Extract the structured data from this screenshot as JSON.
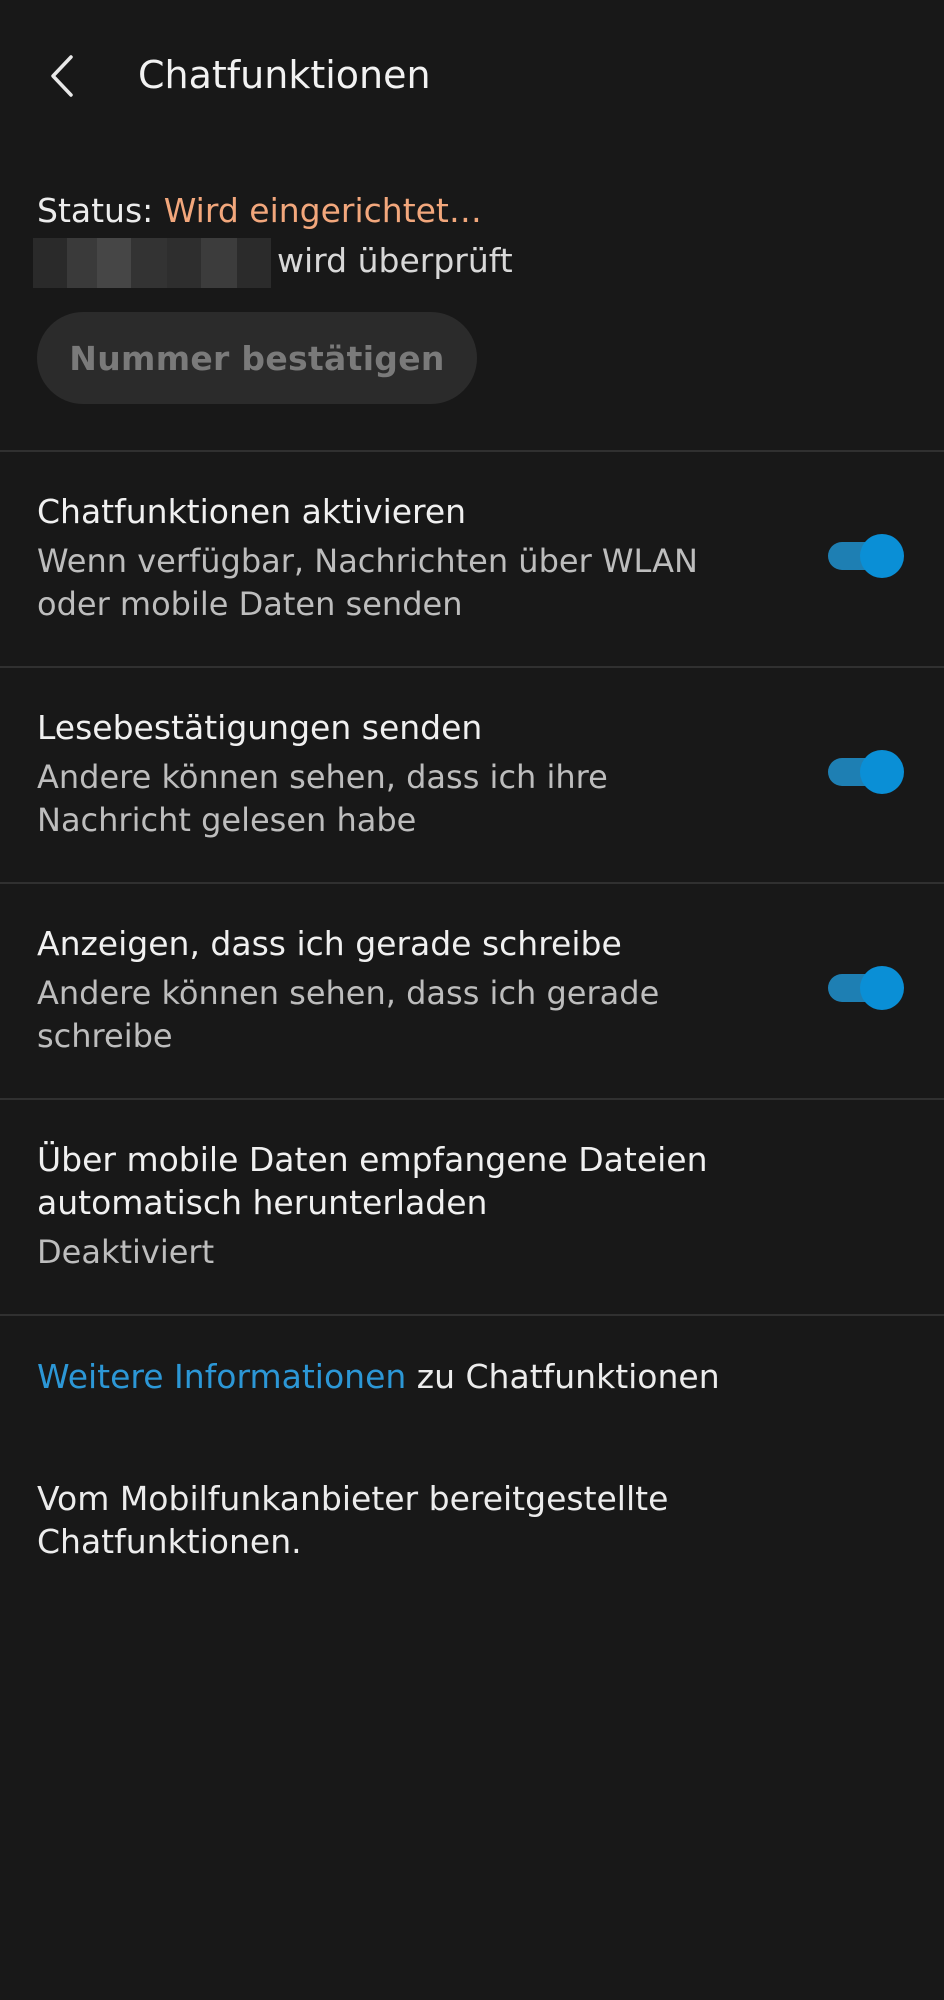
{
  "header": {
    "title": "Chatfunktionen",
    "back_icon": "chevron-left-icon"
  },
  "status": {
    "label": "Status: ",
    "value": "Wird eingerichtet…",
    "value_color": "#f2a77c",
    "check_text": "wird überprüft",
    "confirm_button_label": "Nummer bestätigen"
  },
  "settings": [
    {
      "title": "Chatfunktionen aktivieren",
      "description": "Wenn verfügbar, Nachrichten über WLAN oder mobile Daten senden",
      "toggle_on": true
    },
    {
      "title": "Lesebestätigungen senden",
      "description": "Andere können sehen, dass ich ihre Nachricht gelesen habe",
      "toggle_on": true
    },
    {
      "title": "Anzeigen, dass ich gerade schreibe",
      "description": "Andere können sehen, dass ich gerade schreibe",
      "toggle_on": true
    },
    {
      "title": "Über mobile Daten empfangene Dateien automatisch herunterladen",
      "value": "Deaktiviert"
    }
  ],
  "info": {
    "link_text": "Weitere Informationen",
    "suffix": " zu Chatfunktionen",
    "link_color": "#2c97d6"
  },
  "footer": {
    "carrier_text": "Vom Mobilfunkanbieter bereitgestellte Chatfunktionen."
  },
  "colors": {
    "background": "#181818",
    "accent": "#0a8fd6",
    "divider": "#303030"
  }
}
